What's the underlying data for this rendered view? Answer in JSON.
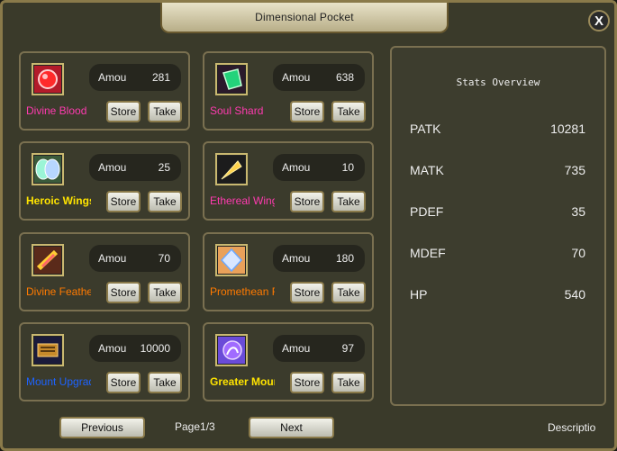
{
  "window": {
    "title": "Dimensional Pocket",
    "close_label": "X"
  },
  "items": [
    {
      "name": "Divine Blood",
      "color": "#ff3bb0",
      "amount_label": "Amou",
      "amount": "281",
      "store": "Store",
      "take": "Take",
      "icon": "blood-orb-icon"
    },
    {
      "name": "Soul Shard",
      "color": "#ff3bb0",
      "amount_label": "Amou",
      "amount": "638",
      "store": "Store",
      "take": "Take",
      "icon": "soul-shard-icon"
    },
    {
      "name": "Heroic Wings",
      "color": "#ffe400",
      "amount_label": "Amou",
      "amount": "25",
      "store": "Store",
      "take": "Take",
      "icon": "wings-icon"
    },
    {
      "name": "Ethereal Wing",
      "color": "#ff3bb0",
      "amount_label": "Amou",
      "amount": "10",
      "store": "Store",
      "take": "Take",
      "icon": "feather-icon"
    },
    {
      "name": "Divine Feathe",
      "color": "#ff7a00",
      "amount_label": "Amou",
      "amount": "70",
      "store": "Store",
      "take": "Take",
      "icon": "divine-feather-icon"
    },
    {
      "name": "Promethean F",
      "color": "#ff7a00",
      "amount_label": "Amou",
      "amount": "180",
      "store": "Store",
      "take": "Take",
      "icon": "crystal-icon"
    },
    {
      "name": "Mount Upgrad",
      "color": "#1d63ff",
      "amount_label": "Amou",
      "amount": "10000",
      "store": "Store",
      "take": "Take",
      "icon": "mount-scroll-icon"
    },
    {
      "name": "Greater Mount",
      "color": "#ffe400",
      "amount_label": "Amou",
      "amount": "97",
      "store": "Store",
      "take": "Take",
      "icon": "greater-mount-icon"
    }
  ],
  "stats": {
    "title": "Stats Overview",
    "rows": [
      {
        "label": "PATK",
        "value": "10281"
      },
      {
        "label": "MATK",
        "value": "735"
      },
      {
        "label": "PDEF",
        "value": "35"
      },
      {
        "label": "MDEF",
        "value": "70"
      },
      {
        "label": "HP",
        "value": "540"
      }
    ]
  },
  "footer": {
    "previous": "Previous",
    "page": "Page1/3",
    "next": "Next",
    "description": "Descriptio"
  }
}
